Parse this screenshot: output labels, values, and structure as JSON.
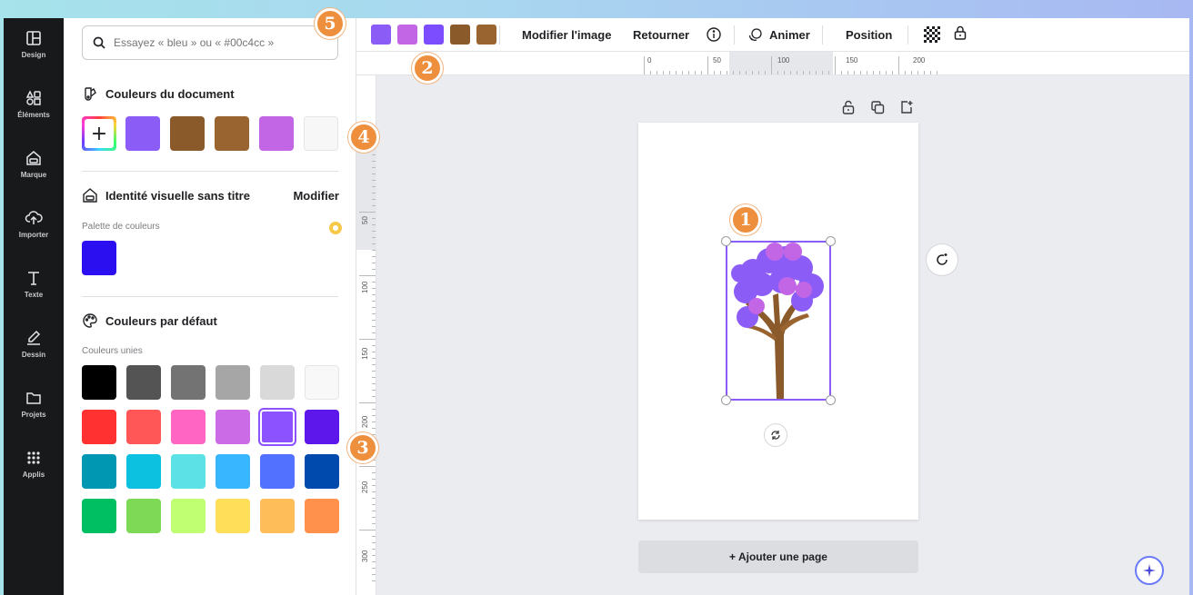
{
  "colors": {
    "purple": "#8b5cf6",
    "pink_purple": "#c266e6",
    "violet": "#7c4dff",
    "brown": "#8b5a2b",
    "brown_light": "#9a6430",
    "brand_blue": "#2b0ff0",
    "badge_orange": "#ee8f3d"
  },
  "rail": {
    "items": [
      {
        "label": "Design",
        "icon": "layout-icon"
      },
      {
        "label": "Éléments",
        "icon": "elements-icon"
      },
      {
        "label": "Marque",
        "icon": "brand-icon"
      },
      {
        "label": "Importer",
        "icon": "upload-icon"
      },
      {
        "label": "Texte",
        "icon": "text-icon"
      },
      {
        "label": "Dessin",
        "icon": "draw-icon"
      },
      {
        "label": "Projets",
        "icon": "folder-icon"
      },
      {
        "label": "Applis",
        "icon": "apps-icon"
      }
    ]
  },
  "panel": {
    "search_placeholder": "Essayez « bleu » ou « #00c4cc »",
    "doc_colors_title": "Couleurs du document",
    "doc_colors": [
      "#8b5cf6",
      "#8b5a2b",
      "#9a6430",
      "#c266e6",
      "#f7f7f8"
    ],
    "brand_title": "Identité visuelle sans titre",
    "brand_modify": "Modifier",
    "palette_label": "Palette de couleurs",
    "palette_colors": [
      "#2b0ff0"
    ],
    "default_title": "Couleurs par défaut",
    "solid_label": "Couleurs unies",
    "solid_rows": [
      [
        "#000000",
        "#545454",
        "#737373",
        "#a6a6a6",
        "#d9d9d9",
        "#f8f8f9"
      ],
      [
        "#ff3131",
        "#ff5757",
        "#ff66c4",
        "#cb6ce6",
        "#8c52ff",
        "#5e17eb"
      ],
      [
        "#0097b2",
        "#0cc0df",
        "#5ce1e6",
        "#38b6ff",
        "#5271ff",
        "#004aad"
      ],
      [
        "#00bf63",
        "#7ed957",
        "#c1ff72",
        "#ffde59",
        "#ffbd59",
        "#ff914d"
      ]
    ]
  },
  "toolbar": {
    "swatches": [
      "#8b5cf6",
      "#c266e6",
      "#7c4dff",
      "#8b5a2b",
      "#9a6430"
    ],
    "edit_image": "Modifier l'image",
    "flip": "Retourner",
    "animate": "Animer",
    "position": "Position"
  },
  "ruler": {
    "h_labels": [
      "0",
      "50",
      "100",
      "150",
      "200"
    ],
    "v_labels": [
      "50",
      "100",
      "150",
      "200",
      "250",
      "300"
    ]
  },
  "canvas": {
    "add_page": "+ Ajouter une page"
  },
  "badges": [
    "1",
    "2",
    "3",
    "4",
    "5"
  ]
}
